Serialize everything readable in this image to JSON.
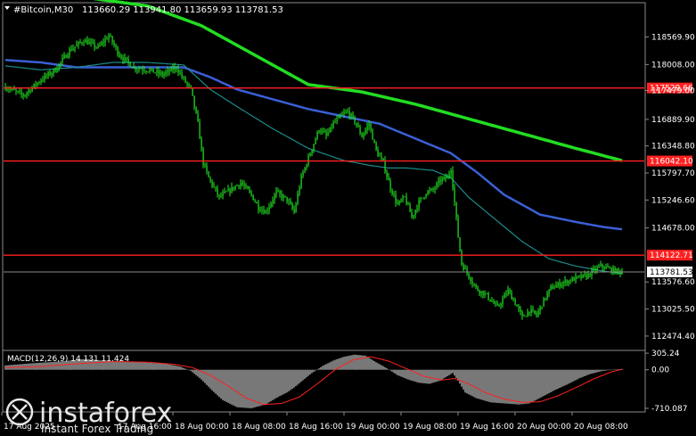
{
  "header": {
    "symbol": "#Bitcoin,M30",
    "ohlc": "113660.29 113941.80 113659.93 113781.53"
  },
  "watermark": {
    "brand": "instaforex",
    "slogan": "Instant Forex Trading"
  },
  "colors": {
    "background": "#000000",
    "candle": "#22ee22",
    "ma_fast": "#1d8a8a",
    "ma_mid": "#3b5fd6",
    "ma_slow": "#22dd22",
    "level": "#ff2020",
    "macd_hist": "#c8c8c8",
    "macd_signal": "#ff2020"
  },
  "chart_data": {
    "type": "candlestick",
    "price_axis": {
      "range": [
        112200,
        119250
      ],
      "ticks": [
        "118569.90",
        "118008.00",
        "117479.00",
        "116889.90",
        "116348.80",
        "115797.70",
        "115246.60",
        "114678.00",
        "113576.60",
        "113025.50",
        "112474.40"
      ]
    },
    "time_axis": {
      "ticks": [
        "17 Aug 2025",
        "17 Aug 16:00",
        "18 Aug 00:00",
        "18 Aug 08:00",
        "18 Aug 16:00",
        "19 Aug 00:00",
        "19 Aug 08:00",
        "19 Aug 16:00",
        "20 Aug 00:00",
        "20 Aug 08:00"
      ]
    },
    "levels": [
      {
        "label": "117529.66",
        "value": 117529.66
      },
      {
        "label": "116042.10",
        "value": 116042.1
      },
      {
        "label": "114122.71",
        "value": 114122.71
      }
    ],
    "current_price": {
      "label": "113781.53",
      "value": 113781.53
    },
    "close_path": [
      [
        0,
        117550
      ],
      [
        10,
        117380
      ],
      [
        20,
        117700
      ],
      [
        28,
        117900
      ],
      [
        36,
        118300
      ],
      [
        44,
        118500
      ],
      [
        52,
        118350
      ],
      [
        58,
        118600
      ],
      [
        64,
        118200
      ],
      [
        72,
        117950
      ],
      [
        80,
        117900
      ],
      [
        88,
        117800
      ],
      [
        96,
        117950
      ],
      [
        100,
        117700
      ],
      [
        104,
        117500
      ],
      [
        108,
        116800
      ],
      [
        111,
        116000
      ],
      [
        114,
        115700
      ],
      [
        120,
        115300
      ],
      [
        126,
        115450
      ],
      [
        132,
        115600
      ],
      [
        138,
        115350
      ],
      [
        142,
        115100
      ],
      [
        146,
        115000
      ],
      [
        152,
        115400
      ],
      [
        158,
        115250
      ],
      [
        162,
        115000
      ],
      [
        166,
        115700
      ],
      [
        172,
        116300
      ],
      [
        176,
        116700
      ],
      [
        180,
        116550
      ],
      [
        184,
        116800
      ],
      [
        188,
        116950
      ],
      [
        192,
        117050
      ],
      [
        196,
        116850
      ],
      [
        200,
        116550
      ],
      [
        204,
        116800
      ],
      [
        208,
        116250
      ],
      [
        212,
        116000
      ],
      [
        216,
        115500
      ],
      [
        220,
        115150
      ],
      [
        224,
        115300
      ],
      [
        228,
        114900
      ],
      [
        232,
        115200
      ],
      [
        236,
        115400
      ],
      [
        240,
        115450
      ],
      [
        244,
        115650
      ],
      [
        248,
        115700
      ],
      [
        250,
        115900
      ],
      [
        252,
        115200
      ],
      [
        254,
        114500
      ],
      [
        256,
        113950
      ],
      [
        260,
        113700
      ],
      [
        264,
        113450
      ],
      [
        270,
        113300
      ],
      [
        276,
        113050
      ],
      [
        282,
        113400
      ],
      [
        286,
        113150
      ],
      [
        290,
        112850
      ],
      [
        294,
        113000
      ],
      [
        298,
        112900
      ],
      [
        302,
        113200
      ],
      [
        306,
        113450
      ],
      [
        312,
        113550
      ],
      [
        320,
        113650
      ],
      [
        326,
        113700
      ],
      [
        330,
        113800
      ],
      [
        334,
        113900
      ],
      [
        338,
        113850
      ],
      [
        342,
        113800
      ],
      [
        346,
        113781.53
      ]
    ],
    "ma_fast": [
      [
        0,
        117980
      ],
      [
        20,
        117900
      ],
      [
        40,
        117950
      ],
      [
        60,
        118050
      ],
      [
        80,
        118050
      ],
      [
        100,
        118000
      ],
      [
        115,
        117500
      ],
      [
        130,
        117150
      ],
      [
        150,
        116700
      ],
      [
        170,
        116300
      ],
      [
        190,
        116050
      ],
      [
        205,
        115950
      ],
      [
        215,
        115900
      ],
      [
        225,
        115900
      ],
      [
        240,
        115850
      ],
      [
        250,
        115700
      ],
      [
        260,
        115300
      ],
      [
        275,
        114850
      ],
      [
        290,
        114400
      ],
      [
        305,
        114050
      ],
      [
        320,
        113900
      ],
      [
        335,
        113800
      ],
      [
        346,
        113750
      ]
    ],
    "ma_mid": [
      [
        0,
        118100
      ],
      [
        20,
        118050
      ],
      [
        40,
        117950
      ],
      [
        60,
        117950
      ],
      [
        80,
        117950
      ],
      [
        100,
        117950
      ],
      [
        115,
        117750
      ],
      [
        130,
        117500
      ],
      [
        150,
        117300
      ],
      [
        170,
        117100
      ],
      [
        190,
        116950
      ],
      [
        210,
        116800
      ],
      [
        230,
        116500
      ],
      [
        250,
        116200
      ],
      [
        265,
        115800
      ],
      [
        280,
        115350
      ],
      [
        300,
        114950
      ],
      [
        320,
        114800
      ],
      [
        335,
        114700
      ],
      [
        346,
        114650
      ]
    ],
    "ma_slow": [
      [
        0,
        119550
      ],
      [
        40,
        119400
      ],
      [
        80,
        119200
      ],
      [
        110,
        118800
      ],
      [
        140,
        118200
      ],
      [
        170,
        117600
      ],
      [
        200,
        117450
      ],
      [
        230,
        117200
      ],
      [
        260,
        116900
      ],
      [
        290,
        116600
      ],
      [
        320,
        116300
      ],
      [
        346,
        116050
      ]
    ],
    "macd": {
      "label": "MACD(12,26,9) 14.131 11.424",
      "params": "12,26,9",
      "main": 14.131,
      "signal_value": 11.424,
      "range": [
        -760,
        340
      ],
      "ticks": [
        "305.24",
        "0.00",
        "-710.087"
      ],
      "hist": [
        [
          0,
          80
        ],
        [
          15,
          120
        ],
        [
          30,
          150
        ],
        [
          45,
          200
        ],
        [
          55,
          170
        ],
        [
          70,
          150
        ],
        [
          80,
          130
        ],
        [
          90,
          110
        ],
        [
          98,
          60
        ],
        [
          104,
          -20
        ],
        [
          110,
          -180
        ],
        [
          116,
          -380
        ],
        [
          122,
          -560
        ],
        [
          130,
          -690
        ],
        [
          138,
          -710
        ],
        [
          146,
          -640
        ],
        [
          152,
          -520
        ],
        [
          158,
          -420
        ],
        [
          162,
          -330
        ],
        [
          166,
          -220
        ],
        [
          172,
          -60
        ],
        [
          178,
          70
        ],
        [
          184,
          170
        ],
        [
          190,
          240
        ],
        [
          196,
          280
        ],
        [
          202,
          260
        ],
        [
          208,
          140
        ],
        [
          214,
          30
        ],
        [
          220,
          -100
        ],
        [
          226,
          -180
        ],
        [
          232,
          -240
        ],
        [
          238,
          -260
        ],
        [
          244,
          -200
        ],
        [
          248,
          -120
        ],
        [
          251,
          -60
        ],
        [
          254,
          -200
        ],
        [
          258,
          -420
        ],
        [
          264,
          -520
        ],
        [
          272,
          -600
        ],
        [
          280,
          -620
        ],
        [
          288,
          -640
        ],
        [
          294,
          -620
        ],
        [
          300,
          -520
        ],
        [
          308,
          -380
        ],
        [
          316,
          -260
        ],
        [
          322,
          -160
        ],
        [
          328,
          -80
        ],
        [
          334,
          -30
        ],
        [
          340,
          0
        ],
        [
          346,
          14
        ]
      ],
      "signal": [
        [
          0,
          40
        ],
        [
          20,
          60
        ],
        [
          40,
          110
        ],
        [
          60,
          150
        ],
        [
          80,
          140
        ],
        [
          95,
          100
        ],
        [
          105,
          40
        ],
        [
          115,
          -100
        ],
        [
          125,
          -300
        ],
        [
          135,
          -520
        ],
        [
          145,
          -640
        ],
        [
          155,
          -620
        ],
        [
          165,
          -500
        ],
        [
          175,
          -260
        ],
        [
          185,
          0
        ],
        [
          195,
          180
        ],
        [
          205,
          240
        ],
        [
          215,
          160
        ],
        [
          225,
          20
        ],
        [
          235,
          -120
        ],
        [
          245,
          -190
        ],
        [
          252,
          -160
        ],
        [
          260,
          -260
        ],
        [
          270,
          -430
        ],
        [
          280,
          -540
        ],
        [
          290,
          -600
        ],
        [
          300,
          -590
        ],
        [
          310,
          -480
        ],
        [
          320,
          -330
        ],
        [
          330,
          -170
        ],
        [
          340,
          -40
        ],
        [
          346,
          11
        ]
      ]
    }
  }
}
